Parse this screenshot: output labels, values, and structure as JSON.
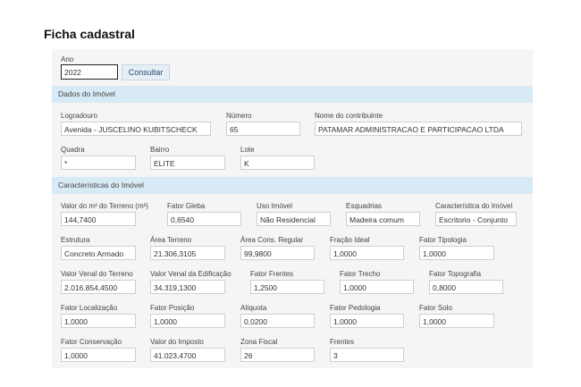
{
  "page": {
    "title": "Ficha cadastral"
  },
  "query": {
    "ano_label": "Ano",
    "ano_value": "2022",
    "consultar_label": "Consultar"
  },
  "dados": {
    "heading": "Dados do Imóvel",
    "fields": [
      {
        "label": "Logradouro",
        "value": "Avenida - JUSCELINO KUBITSCHECK"
      },
      {
        "label": "Número",
        "value": "65"
      },
      {
        "label": "Nome do contribuinte",
        "value": "PATAMAR ADMINISTRACAO E PARTICIPACAO LTDA"
      },
      {
        "label": "Quadra",
        "value": "*"
      },
      {
        "label": "Bairro",
        "value": "ELITE"
      },
      {
        "label": "Lote",
        "value": "K"
      }
    ]
  },
  "caracteristicas": {
    "heading": "Características do Imóvel",
    "fields": [
      {
        "label": "Valor do m² do Terreno (m²)",
        "value": "144,7400"
      },
      {
        "label": "Fator Gleba",
        "value": "0,6540"
      },
      {
        "label": "Uso Imóvel",
        "value": "Não Residencial"
      },
      {
        "label": "Esquadrias",
        "value": "Madeira comum"
      },
      {
        "label": "Característica do Imóvel",
        "value": "Escritorio - Conjunto"
      },
      {
        "label": "Estrutura",
        "value": "Concreto Armado"
      },
      {
        "label": "Área Terreno",
        "value": "21.306,3105"
      },
      {
        "label": "Área Cons. Regular",
        "value": "99,9800"
      },
      {
        "label": "Fração Ideal",
        "value": "1,0000"
      },
      {
        "label": "Fator Tipologia",
        "value": "1,0000"
      },
      {
        "label": "Valor Venal do Terreno",
        "value": "2.016.854,4500"
      },
      {
        "label": "Valor Venal da Edificação",
        "value": "34.319,1300"
      },
      {
        "label": "Fator Frentes",
        "value": "1,2500"
      },
      {
        "label": "Fator Trecho",
        "value": "1,0000"
      },
      {
        "label": "Fator Topografia",
        "value": "0,8000"
      },
      {
        "label": "Fator Localização",
        "value": "1,0000"
      },
      {
        "label": "Fator Posição",
        "value": "1,0000"
      },
      {
        "label": "Alíquota",
        "value": "0,0200"
      },
      {
        "label": "Fator Pedologia",
        "value": "1,0000"
      },
      {
        "label": "Fator Solo",
        "value": "1,0000"
      },
      {
        "label": "Fator Conservação",
        "value": "1,0000"
      },
      {
        "label": "Valor do Imposto",
        "value": "41.023,4700"
      },
      {
        "label": "Zona Fiscal",
        "value": "26"
      },
      {
        "label": "Frentes",
        "value": "3"
      }
    ]
  }
}
